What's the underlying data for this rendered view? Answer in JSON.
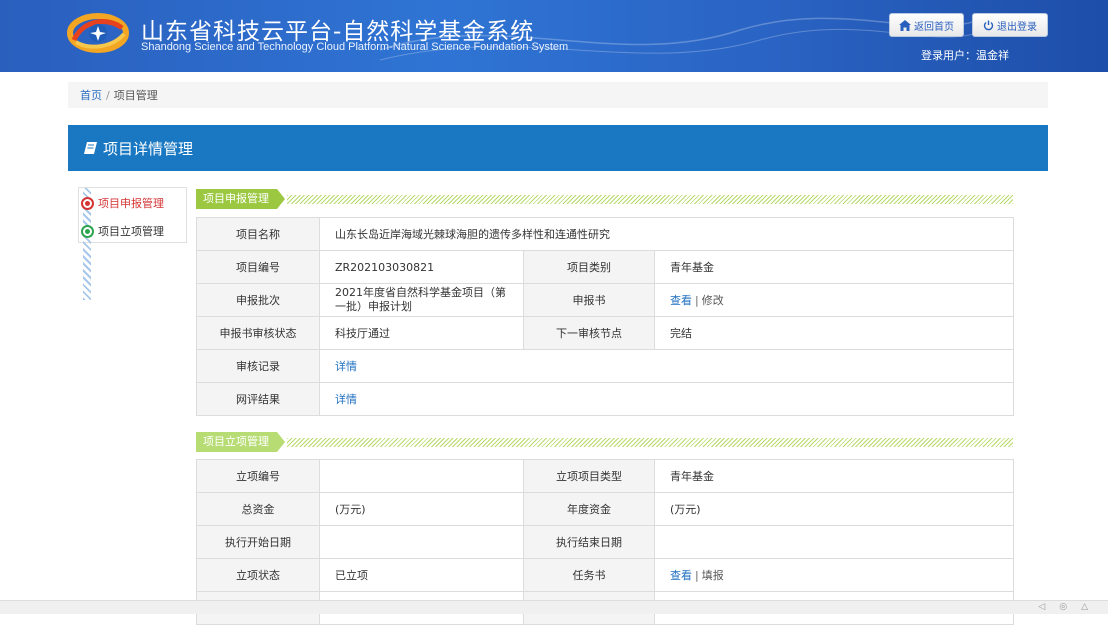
{
  "header": {
    "title_cn": "山东省科技云平台-自然科学基金系统",
    "title_en": "Shandong Science and Technology Cloud Platform-Natural Science Foundation System",
    "home_button": "返回首页",
    "logout_button": "退出登录",
    "user_label": "登录用户：温金祥"
  },
  "breadcrumb": {
    "home": "首页",
    "separator": "/",
    "current": "项目管理"
  },
  "panel": {
    "title": "项目详情管理"
  },
  "left_menu": {
    "items": [
      {
        "label": "项目申报管理",
        "active": true
      },
      {
        "label": "项目立项管理",
        "active": false
      }
    ]
  },
  "section1": {
    "tag": "项目申报管理",
    "rows": {
      "name_label": "项目名称",
      "name_value": "山东长岛近岸海域光棘球海胆的遗传多样性和连通性研究",
      "code_label": "项目编号",
      "code_value": "ZR202103030821",
      "type_label": "项目类别",
      "type_value": "青年基金",
      "batch_label": "申报批次",
      "batch_value": "2021年度省自然科学基金项目（第一批）申报计划",
      "book_label": "申报书",
      "book_view": "查看",
      "book_edit": "修改",
      "audit_status_label": "申报书审核状态",
      "audit_status_value": "科技厅通过",
      "next_node_label": "下一审核节点",
      "next_node_value": "完结",
      "audit_record_label": "审核记录",
      "audit_record_link": "详情",
      "review_result_label": "网评结果",
      "review_result_link": "详情"
    }
  },
  "section2": {
    "tag": "项目立项管理",
    "rows": {
      "approval_no_label": "立项编号",
      "approval_no_value": "",
      "approval_type_label": "立项项目类型",
      "approval_type_value": "青年基金",
      "total_fund_label": "总资金",
      "total_fund_value": "(万元)",
      "annual_fund_label": "年度资金",
      "annual_fund_value": "(万元)",
      "start_date_label": "执行开始日期",
      "start_date_value": "",
      "end_date_label": "执行结束日期",
      "end_date_value": "",
      "status_label": "立项状态",
      "status_value": "已立项",
      "task_book_label": "任务书",
      "task_book_view": "查看",
      "task_book_fill": "填报"
    }
  },
  "colors": {
    "header_blue": "#2f74d4",
    "panel_blue": "#1a78c2",
    "tag_green": "#9bc840",
    "link_blue": "#1f6fc1",
    "active_red": "#d53434"
  }
}
